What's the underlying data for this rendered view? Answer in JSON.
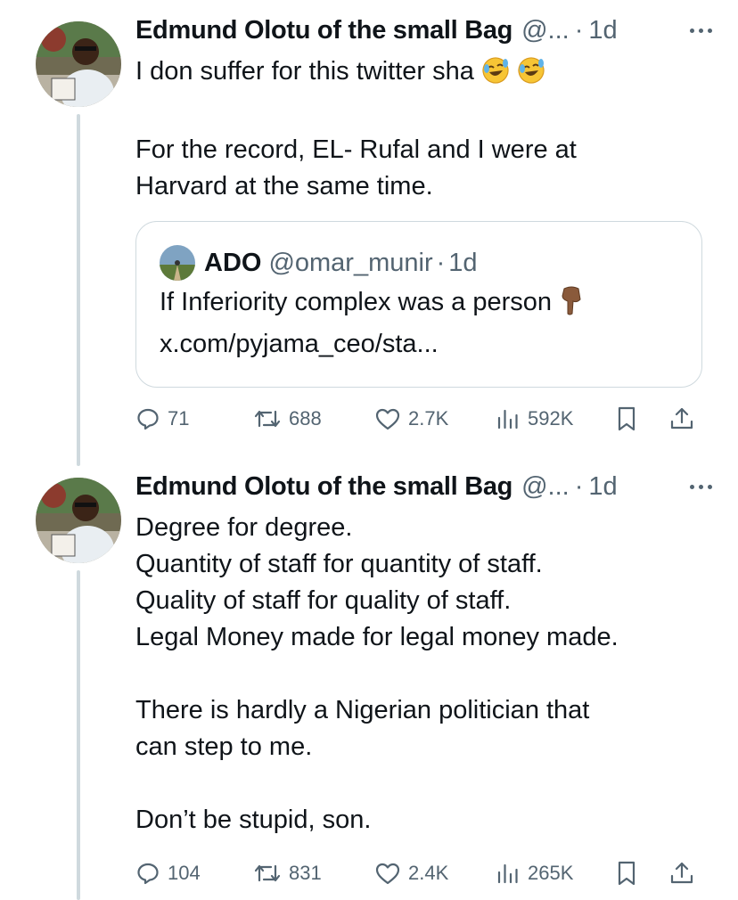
{
  "tweets": [
    {
      "author": {
        "name": "Edmund Olotu of the small Bag",
        "handle": "@...",
        "time": "1d"
      },
      "text_line1": "I don suffer for this twitter sha",
      "text_rest": "For the record, EL- Rufal and I were at\nHarvard at the same time.",
      "quote": {
        "name": "ADO",
        "handle": "@omar_munir",
        "time": "1d",
        "text_line1": "If Inferiority complex was a person",
        "text_line2": "x.com/pyjama_ceo/sta..."
      },
      "stats": {
        "replies": "71",
        "reposts": "688",
        "likes": "2.7K",
        "views": "592K"
      }
    },
    {
      "author": {
        "name": "Edmund Olotu of the small Bag",
        "handle": "@...",
        "time": "1d"
      },
      "text": "Degree for degree.\nQuantity of staff for quantity of staff.\nQuality of staff for quality of staff.\nLegal Money made for legal money made.\n\nThere is hardly a Nigerian politician that\ncan step to me.\n\nDon’t be stupid, son.",
      "stats": {
        "replies": "104",
        "reposts": "831",
        "likes": "2.4K",
        "views": "265K"
      }
    }
  ],
  "icons": {
    "reply": "reply-icon",
    "repost": "repost-icon",
    "like": "heart-icon",
    "views": "views-icon",
    "bookmark": "bookmark-icon",
    "share": "share-icon",
    "more": "more-icon",
    "emoji": "rolling-on-floor-laughing-emoji",
    "pointing": "pointing-down-emoji"
  },
  "colors": {
    "text": "#0f1419",
    "secondary": "#536471",
    "border": "#cfd9de",
    "background": "#ffffff"
  }
}
